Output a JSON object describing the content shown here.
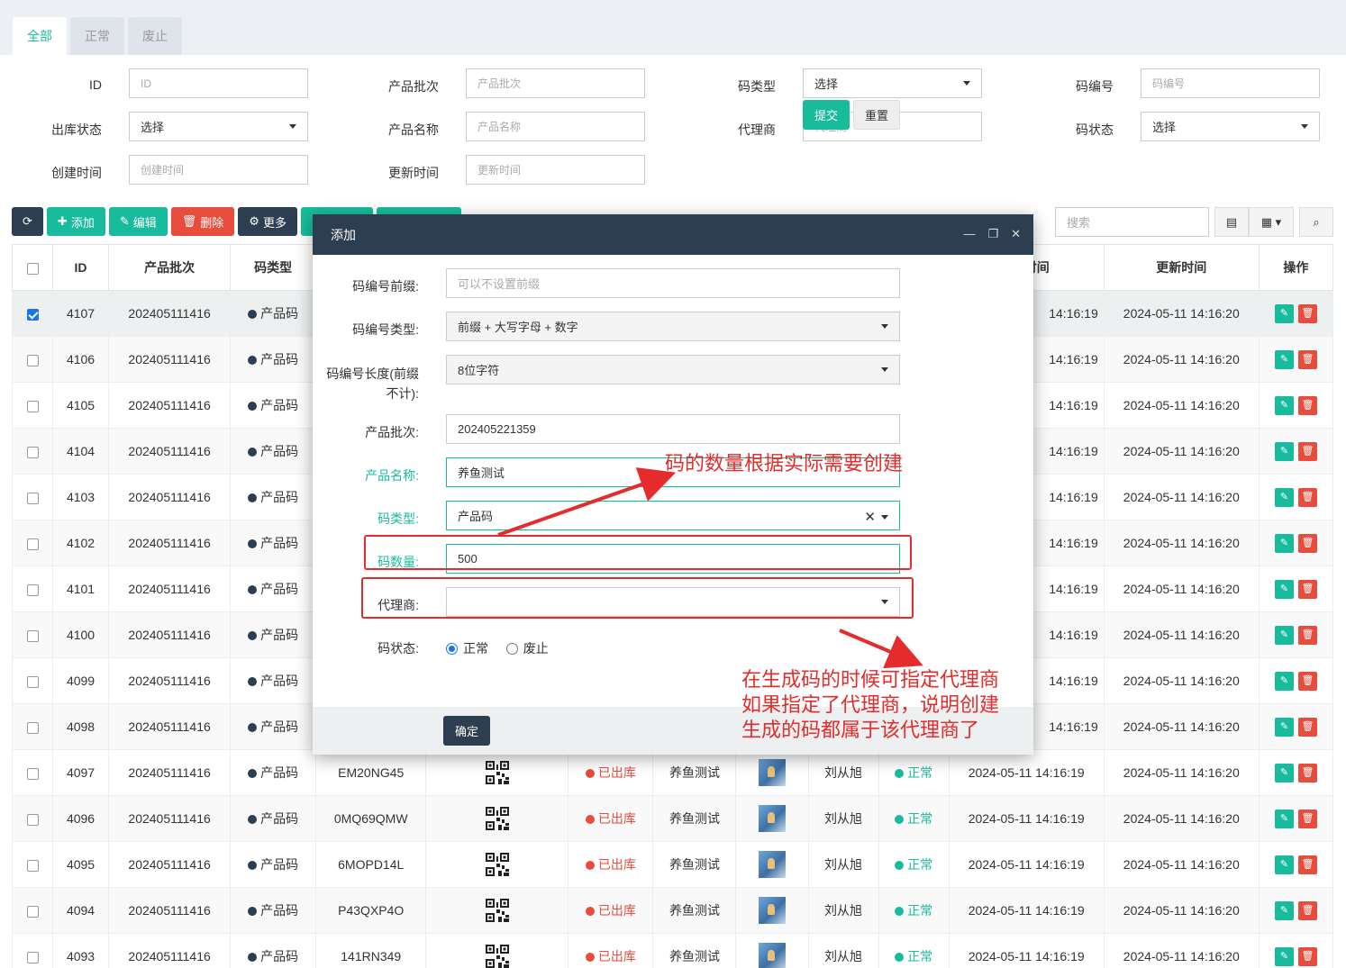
{
  "tabs": [
    "全部",
    "正常",
    "废止"
  ],
  "filters": {
    "id_label": "ID",
    "id_ph": "ID",
    "batch_label": "产品批次",
    "batch_ph": "产品批次",
    "codetype_label": "码类型",
    "codetype_val": "选择",
    "codeno_label": "码编号",
    "codeno_ph": "码编号",
    "outstatus_label": "出库状态",
    "outstatus_val": "选择",
    "pname_label": "产品名称",
    "pname_ph": "产品名称",
    "agent_label": "代理商",
    "agent_ph": "代理商",
    "codestatus_label": "码状态",
    "codestatus_val": "选择",
    "ctime_label": "创建时间",
    "ctime_ph": "创建时间",
    "utime_label": "更新时间",
    "utime_ph": "更新时间",
    "submit": "提交",
    "reset": "重置"
  },
  "toolbar": {
    "add": "添加",
    "edit": "编辑",
    "delete": "删除",
    "more": "更多",
    "search_ph": "搜索"
  },
  "table": {
    "headers": [
      "ID",
      "产品批次",
      "码类型",
      "",
      "",
      "",
      "",
      "",
      "",
      "",
      "时间",
      "更新时间",
      "操作"
    ],
    "rows": [
      {
        "id": "4107",
        "batch": "202405111416",
        "type": "产品码",
        "ctime": "14:16:19",
        "utime": "2024-05-11 14:16:20",
        "checked": true
      },
      {
        "id": "4106",
        "batch": "202405111416",
        "type": "产品码",
        "ctime": "14:16:19",
        "utime": "2024-05-11 14:16:20"
      },
      {
        "id": "4105",
        "batch": "202405111416",
        "type": "产品码",
        "ctime": "14:16:19",
        "utime": "2024-05-11 14:16:20"
      },
      {
        "id": "4104",
        "batch": "202405111416",
        "type": "产品码",
        "ctime": "14:16:19",
        "utime": "2024-05-11 14:16:20"
      },
      {
        "id": "4103",
        "batch": "202405111416",
        "type": "产品码",
        "ctime": "14:16:19",
        "utime": "2024-05-11 14:16:20"
      },
      {
        "id": "4102",
        "batch": "202405111416",
        "type": "产品码",
        "ctime": "14:16:19",
        "utime": "2024-05-11 14:16:20"
      },
      {
        "id": "4101",
        "batch": "202405111416",
        "type": "产品码",
        "ctime": "14:16:19",
        "utime": "2024-05-11 14:16:20"
      },
      {
        "id": "4100",
        "batch": "202405111416",
        "type": "产品码",
        "ctime": "14:16:19",
        "utime": "2024-05-11 14:16:20"
      },
      {
        "id": "4099",
        "batch": "202405111416",
        "type": "产品码",
        "ctime": "14:16:19",
        "utime": "2024-05-11 14:16:20"
      },
      {
        "id": "4098",
        "batch": "202405111416",
        "type": "产品码",
        "ctime": "14:16:19",
        "utime": "2024-05-11 14:16:20"
      },
      {
        "id": "4097",
        "batch": "202405111416",
        "type": "产品码",
        "code": "EM20NG45",
        "out": "已出库",
        "pname": "养鱼测试",
        "agent": "刘从旭",
        "status": "正常",
        "ctime": "2024-05-11 14:16:19",
        "utime": "2024-05-11 14:16:20"
      },
      {
        "id": "4096",
        "batch": "202405111416",
        "type": "产品码",
        "code": "0MQ69QMW",
        "out": "已出库",
        "pname": "养鱼测试",
        "agent": "刘从旭",
        "status": "正常",
        "ctime": "2024-05-11 14:16:19",
        "utime": "2024-05-11 14:16:20"
      },
      {
        "id": "4095",
        "batch": "202405111416",
        "type": "产品码",
        "code": "6MOPD14L",
        "out": "已出库",
        "pname": "养鱼测试",
        "agent": "刘从旭",
        "status": "正常",
        "ctime": "2024-05-11 14:16:19",
        "utime": "2024-05-11 14:16:20"
      },
      {
        "id": "4094",
        "batch": "202405111416",
        "type": "产品码",
        "code": "P43QXP4O",
        "out": "已出库",
        "pname": "养鱼测试",
        "agent": "刘从旭",
        "status": "正常",
        "ctime": "2024-05-11 14:16:19",
        "utime": "2024-05-11 14:16:20"
      },
      {
        "id": "4093",
        "batch": "202405111416",
        "type": "产品码",
        "code": "141RN349",
        "out": "已出库",
        "pname": "养鱼测试",
        "agent": "刘从旭",
        "status": "正常",
        "ctime": "2024-05-11 14:16:19",
        "utime": "2024-05-11 14:16:20"
      }
    ]
  },
  "modal": {
    "title": "添加",
    "prefix_label": "码编号前缀:",
    "prefix_ph": "可以不设置前缀",
    "codetype_label": "码编号类型:",
    "codetype_val": "前缀 + 大写字母 + 数字",
    "len_label_1": "码编号长度(前缀",
    "len_label_2": "不计):",
    "len_val": "8位字符",
    "batch_label": "产品批次:",
    "batch_val": "202405221359",
    "pname_label": "产品名称:",
    "pname_val": "养鱼测试",
    "type_label": "码类型:",
    "type_val": "产品码",
    "qty_label": "码数量:",
    "qty_val": "500",
    "agent_label": "代理商:",
    "agent_val": "",
    "status_label": "码状态:",
    "status_normal": "正常",
    "status_void": "废止",
    "ok": "确定"
  },
  "annotations": {
    "qty_note": "码的数量根据实际需要创建",
    "agent_note_1": "在生成码的时候可指定代理商",
    "agent_note_2": "如果指定了代理商，说明创建",
    "agent_note_3": "生成的码都属于该代理商了",
    "color": "#e52b2b"
  }
}
